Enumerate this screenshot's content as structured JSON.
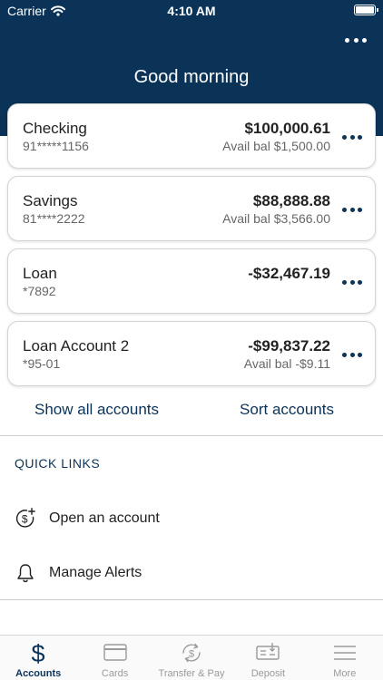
{
  "status_bar": {
    "carrier": "Carrier",
    "time": "4:10 AM"
  },
  "header": {
    "greeting": "Good morning"
  },
  "accounts": [
    {
      "name": "Checking",
      "number": "91*****1156",
      "balance": "$100,000.61",
      "available": "Avail bal $1,500.00"
    },
    {
      "name": "Savings",
      "number": "81****2222",
      "balance": "$88,888.88",
      "available": "Avail bal $3,566.00"
    },
    {
      "name": "Loan",
      "number": "*7892",
      "balance": "-$32,467.19",
      "available": ""
    },
    {
      "name": "Loan Account 2",
      "number": "*95-01",
      "balance": "-$99,837.22",
      "available": "Avail bal -$9.11"
    }
  ],
  "account_actions": {
    "show_all": "Show all accounts",
    "sort": "Sort accounts"
  },
  "quick_links": {
    "title": "QUICK LINKS",
    "items": [
      {
        "label": "Open an account",
        "icon": "dollar-plus-icon"
      },
      {
        "label": "Manage Alerts",
        "icon": "bell-icon"
      }
    ]
  },
  "tab_bar": [
    {
      "label": "Accounts",
      "icon": "dollar-icon",
      "active": true
    },
    {
      "label": "Cards",
      "icon": "card-icon",
      "active": false
    },
    {
      "label": "Transfer & Pay",
      "icon": "transfer-icon",
      "active": false
    },
    {
      "label": "Deposit",
      "icon": "check-deposit-icon",
      "active": false
    },
    {
      "label": "More",
      "icon": "menu-icon",
      "active": false
    }
  ],
  "colors": {
    "brand": "#0b3358",
    "inactive": "#9a9a9a"
  }
}
